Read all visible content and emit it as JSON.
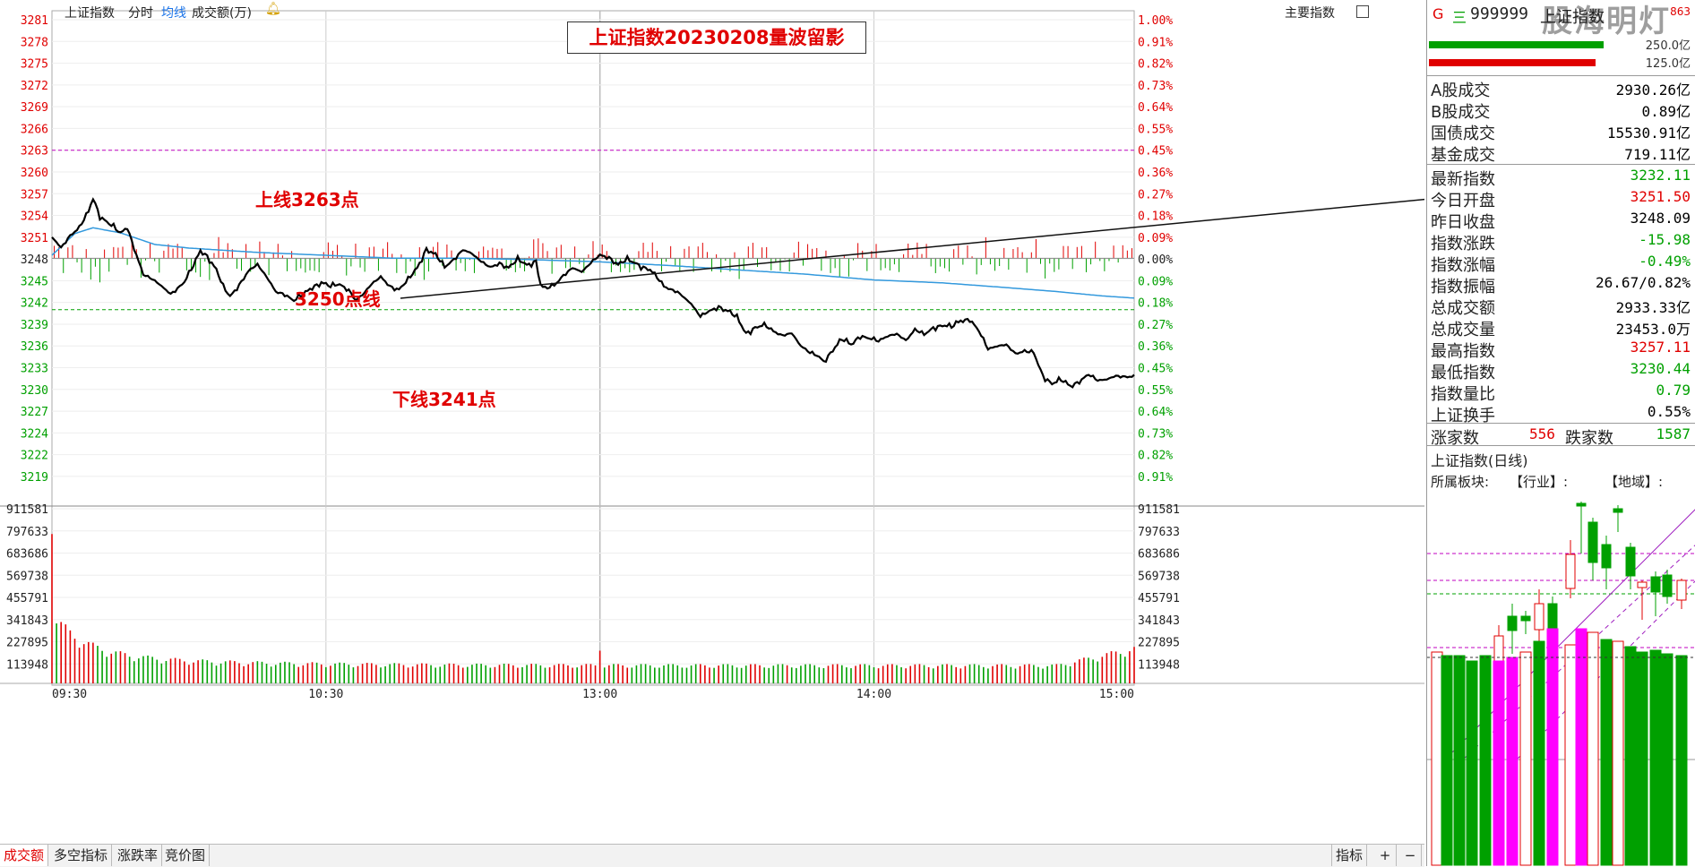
{
  "topbar": {
    "index_name": "上证指数",
    "tab_fenshi": "分时",
    "tab_junxian": "均线",
    "tab_volume": "成交额(万)",
    "indicator_label": "主要指数"
  },
  "title": "上证指数20230208量波留影",
  "annotations": {
    "upper_line": "上线3263点",
    "line_3250": "3250点线",
    "lower_line": "下线3241点"
  },
  "price_axis": {
    "left_labels": [
      "3281",
      "3278",
      "3275",
      "3272",
      "3269",
      "3266",
      "3263",
      "3260",
      "3257",
      "3254",
      "3251",
      "3248",
      "3245",
      "3242",
      "3239",
      "3236",
      "3233",
      "3230",
      "3227",
      "3224",
      "3222",
      "3219"
    ],
    "right_labels": [
      "1.00%",
      "0.91%",
      "0.82%",
      "0.73%",
      "0.64%",
      "0.55%",
      "0.45%",
      "0.36%",
      "0.27%",
      "0.18%",
      "0.09%",
      "0.00%",
      "0.09%",
      "0.18%",
      "0.27%",
      "0.36%",
      "0.45%",
      "0.55%",
      "0.64%",
      "0.73%",
      "0.82%",
      "0.91%"
    ]
  },
  "volume_axis": {
    "labels": [
      "911581",
      "797633",
      "683686",
      "569738",
      "455791",
      "341843",
      "227895",
      "113948"
    ]
  },
  "time_axis": {
    "labels": [
      "09:30",
      "10:30",
      "13:00",
      "14:00",
      "15:00"
    ]
  },
  "chart_data": {
    "type": "line",
    "title": "上证指数20230208量波留影",
    "prev_close": 3248.09,
    "ylim": [
      3217,
      3281
    ],
    "x_range": [
      "09:30",
      "15:00"
    ],
    "price_waypoints": [
      [
        0,
        3251.0
      ],
      [
        4,
        3249.6
      ],
      [
        8,
        3251.3
      ],
      [
        12,
        3252.2
      ],
      [
        16,
        3254.5
      ],
      [
        18,
        3256.5
      ],
      [
        21,
        3254.0
      ],
      [
        25,
        3252.8
      ],
      [
        30,
        3251.5
      ],
      [
        33,
        3252.5
      ],
      [
        36,
        3249.5
      ],
      [
        40,
        3245.8
      ],
      [
        45,
        3245.0
      ],
      [
        52,
        3243.2
      ],
      [
        58,
        3244.8
      ],
      [
        62,
        3247.0
      ],
      [
        65,
        3249.2
      ],
      [
        68,
        3248.5
      ],
      [
        72,
        3246.5
      ],
      [
        75,
        3244.0
      ],
      [
        78,
        3242.8
      ],
      [
        82,
        3244.5
      ],
      [
        86,
        3246.3
      ],
      [
        90,
        3247.2
      ],
      [
        94,
        3245.5
      ],
      [
        98,
        3243.5
      ],
      [
        102,
        3243.2
      ],
      [
        106,
        3242.2
      ],
      [
        110,
        3243.0
      ],
      [
        114,
        3244.2
      ],
      [
        118,
        3244.8
      ],
      [
        122,
        3244.1
      ],
      [
        126,
        3244.5
      ],
      [
        130,
        3243.8
      ],
      [
        133,
        3242.3
      ],
      [
        136,
        3243.0
      ],
      [
        140,
        3244.5
      ],
      [
        144,
        3245.5
      ],
      [
        148,
        3244.3
      ],
      [
        152,
        3243.8
      ],
      [
        156,
        3245.0
      ],
      [
        160,
        3246.8
      ],
      [
        164,
        3249.5
      ],
      [
        168,
        3248.5
      ],
      [
        172,
        3246.8
      ],
      [
        176,
        3248.0
      ],
      [
        180,
        3249.3
      ],
      [
        184,
        3248.7
      ],
      [
        188,
        3247.6
      ],
      [
        192,
        3246.8
      ],
      [
        196,
        3247.5
      ],
      [
        200,
        3246.8
      ],
      [
        204,
        3247.8
      ],
      [
        208,
        3247.2
      ],
      [
        212,
        3247.8
      ],
      [
        214,
        3244.5
      ],
      [
        216,
        3243.8
      ],
      [
        220,
        3244.3
      ],
      [
        224,
        3245.8
      ],
      [
        228,
        3246.8
      ],
      [
        232,
        3246.2
      ],
      [
        236,
        3247.4
      ],
      [
        240,
        3248.5
      ],
      [
        244,
        3248.3
      ],
      [
        248,
        3247.2
      ],
      [
        252,
        3247.8
      ],
      [
        256,
        3247.4
      ],
      [
        262,
        3246.5
      ],
      [
        268,
        3244.2
      ],
      [
        274,
        3243.5
      ],
      [
        280,
        3241.8
      ],
      [
        284,
        3240.0
      ],
      [
        288,
        3240.8
      ],
      [
        292,
        3241.5
      ],
      [
        296,
        3240.8
      ],
      [
        300,
        3239.8
      ],
      [
        304,
        3237.8
      ],
      [
        308,
        3238.6
      ],
      [
        312,
        3238.8
      ],
      [
        316,
        3238.0
      ],
      [
        320,
        3237.5
      ],
      [
        324,
        3237.8
      ],
      [
        328,
        3236.0
      ],
      [
        332,
        3235.0
      ],
      [
        336,
        3234.5
      ],
      [
        338,
        3233.9
      ],
      [
        342,
        3235.5
      ],
      [
        346,
        3236.8
      ],
      [
        350,
        3236.2
      ],
      [
        354,
        3237.5
      ],
      [
        358,
        3237.0
      ],
      [
        362,
        3236.6
      ],
      [
        366,
        3237.4
      ],
      [
        370,
        3237.7
      ],
      [
        374,
        3236.8
      ],
      [
        378,
        3238.2
      ],
      [
        382,
        3237.5
      ],
      [
        386,
        3238.6
      ],
      [
        390,
        3238.9
      ],
      [
        394,
        3238.5
      ],
      [
        398,
        3239.5
      ],
      [
        402,
        3239.8
      ],
      [
        406,
        3238.0
      ],
      [
        410,
        3235.5
      ],
      [
        414,
        3236.0
      ],
      [
        418,
        3236.2
      ],
      [
        422,
        3235.0
      ],
      [
        426,
        3235.2
      ],
      [
        430,
        3235.0
      ],
      [
        434,
        3232.0
      ],
      [
        438,
        3230.8
      ],
      [
        442,
        3231.2
      ],
      [
        446,
        3230.5
      ],
      [
        450,
        3231.2
      ],
      [
        454,
        3232.0
      ],
      [
        458,
        3231.2
      ],
      [
        462,
        3231.4
      ],
      [
        466,
        3231.9
      ],
      [
        470,
        3231.8
      ],
      [
        474,
        3231.7
      ]
    ],
    "avg_waypoints": [
      [
        0,
        3248.5
      ],
      [
        10,
        3251.5
      ],
      [
        18,
        3252.3
      ],
      [
        30,
        3251.6
      ],
      [
        45,
        3250.0
      ],
      [
        60,
        3249.5
      ],
      [
        90,
        3248.9
      ],
      [
        120,
        3248.5
      ],
      [
        150,
        3248.1
      ],
      [
        180,
        3248.1
      ],
      [
        210,
        3247.9
      ],
      [
        240,
        3247.6
      ],
      [
        270,
        3247.1
      ],
      [
        300,
        3246.5
      ],
      [
        330,
        3245.9
      ],
      [
        360,
        3245.1
      ],
      [
        390,
        3244.7
      ],
      [
        420,
        3244.0
      ],
      [
        440,
        3243.5
      ],
      [
        460,
        3242.9
      ],
      [
        474,
        3242.6
      ]
    ],
    "reference_lines": [
      {
        "label": "上线3263点",
        "value": 3263
      },
      {
        "label": "下线3241点",
        "value": 3241
      }
    ]
  },
  "right_panel": {
    "header_code": "999999",
    "header_name": "上证指数",
    "header_flag_g": "G",
    "header_flag_e": "三",
    "header_right_1": "863",
    "header_right_2": "250.0亿",
    "header_right_3": "125.0亿",
    "block1": [
      {
        "label": "A股成交",
        "value": "2930.26亿",
        "color": "black"
      },
      {
        "label": "B股成交",
        "value": "0.89亿",
        "color": "black"
      },
      {
        "label": "国债成交",
        "value": "15530.91亿",
        "color": "black"
      },
      {
        "label": "基金成交",
        "value": "719.11亿",
        "color": "black"
      }
    ],
    "block2": [
      {
        "label": "最新指数",
        "value": "3232.11",
        "color": "green"
      },
      {
        "label": "今日开盘",
        "value": "3251.50",
        "color": "red"
      },
      {
        "label": "昨日收盘",
        "value": "3248.09",
        "color": "black"
      },
      {
        "label": "指数涨跌",
        "value": "-15.98",
        "color": "green"
      },
      {
        "label": "指数涨幅",
        "value": "-0.49%",
        "color": "green"
      },
      {
        "label": "指数振幅",
        "value": "26.67/0.82%",
        "color": "black"
      },
      {
        "label": "总成交额",
        "value": "2933.33亿",
        "color": "black"
      },
      {
        "label": "总成交量",
        "value": "23453.0万",
        "color": "black"
      },
      {
        "label": "最高指数",
        "value": "3257.11",
        "color": "red"
      },
      {
        "label": "最低指数",
        "value": "3230.44",
        "color": "green"
      },
      {
        "label": "指数量比",
        "value": "0.79",
        "color": "green"
      },
      {
        "label": "上证换手",
        "value": "0.55%",
        "color": "black"
      }
    ],
    "up_label": "涨家数",
    "up_count": "556",
    "down_label": "跌家数",
    "down_count": "1587",
    "daily_title": "上证指数(日线)",
    "sector_label": "所属板块:",
    "industry_label": "【行业】:",
    "region_label": "【地域】:"
  },
  "bottom_tabs": [
    "成交额",
    "多空指标",
    "涨跌率",
    "竞价图"
  ],
  "bottom_right": [
    "指标",
    "+",
    "−"
  ],
  "watermark": "股海明灯",
  "colors": {
    "up": "#e00000",
    "down": "#00a000",
    "price_line": "#000000",
    "avg_line": "#3399dd",
    "ref_line": "#c000c0"
  }
}
